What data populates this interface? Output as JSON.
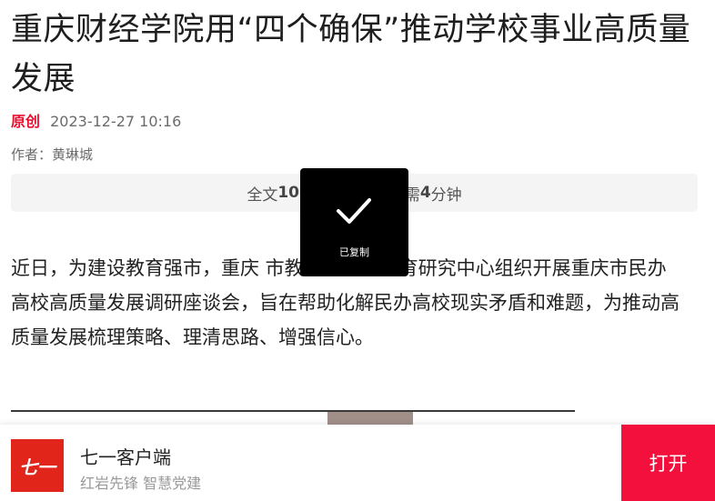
{
  "article": {
    "title": "重庆财经学院用“四个确保”推动学校事业高质量发展",
    "original_badge": "原创",
    "datetime": "2023-12-27 10:16",
    "author": "作者：黄琳城",
    "read_info": {
      "prefix": "全文",
      "count_visible": "101",
      "suffix_visible": "需",
      "minutes": "4",
      "unit": "分钟"
    },
    "body": "近日，为建设教育强市，重庆      市教科院民办教育研究中心组织开展重庆市民办高校高质量发展调研座谈会，旨在帮助化解民办高校现实矛盾和难题，为推动高质量发展梳理策略、理清思路、增强信心。"
  },
  "toast": {
    "icon": "checkmark-icon",
    "text": "已复制"
  },
  "app_banner": {
    "logo_text": "七一",
    "name": "七一客户端",
    "slogan": "红岩先锋 智慧党建",
    "open_label": "打开"
  },
  "colors": {
    "accent_red": "#e8102f",
    "open_button": "#f3103d",
    "logo_bg": "#e1251b",
    "toast_bg": "#000000"
  }
}
